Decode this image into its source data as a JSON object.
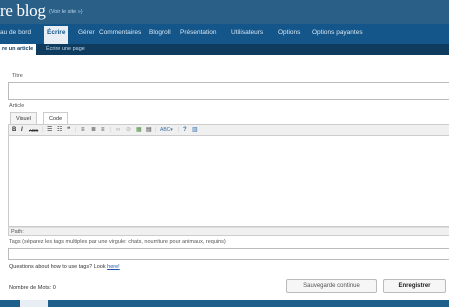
{
  "header": {
    "blog_title": "re blog",
    "view_site": "(Voir le site »)"
  },
  "main_nav": {
    "items": [
      "au de bord",
      "Écrire",
      "Gérer",
      "Commentaires",
      "Blogroll",
      "Présentation",
      "Utilisateurs",
      "Options",
      "Options payantes"
    ],
    "active": "Écrire"
  },
  "sub_nav": {
    "items": [
      "re un article",
      "Écrire une page"
    ],
    "active": "re un article"
  },
  "form": {
    "title_label": "Titre",
    "title_value": "",
    "article_label": "Article",
    "tabs": [
      "Visuel",
      "Code"
    ],
    "active_tab": "Visuel",
    "path_label": "Path:",
    "tags_label": "Tags (séparez les tags multiples par une virgule: chats, nourriture pour animaux, requins)",
    "tags_value": "",
    "tags_help_text": "Questions about how to use tags? Look ",
    "tags_help_link": "here!",
    "word_count": "Nombre de Mots: 0"
  },
  "toolbar": {
    "bold": "B",
    "italic": "I",
    "strike": "ABC",
    "bullet_list": "☰",
    "numbered_list": "☷",
    "blockquote": "❝",
    "align_left": "≡",
    "align_center": "≣",
    "align_right": "≡",
    "link": "∞",
    "unlink": "⊘",
    "insert_more": "▦",
    "page_break": "▤",
    "spellcheck": "ABC▾",
    "help": "?",
    "advanced": "▥"
  },
  "buttons": {
    "save_continue": "Sauvegarde continue",
    "save": "Enregistrer"
  },
  "colors": {
    "header_bg": "#2a5f87",
    "nav_bg": "#14568a",
    "subnav_bg": "#0f3b5e",
    "active_tab_bg": "#e8eef4",
    "link": "#2255aa"
  }
}
